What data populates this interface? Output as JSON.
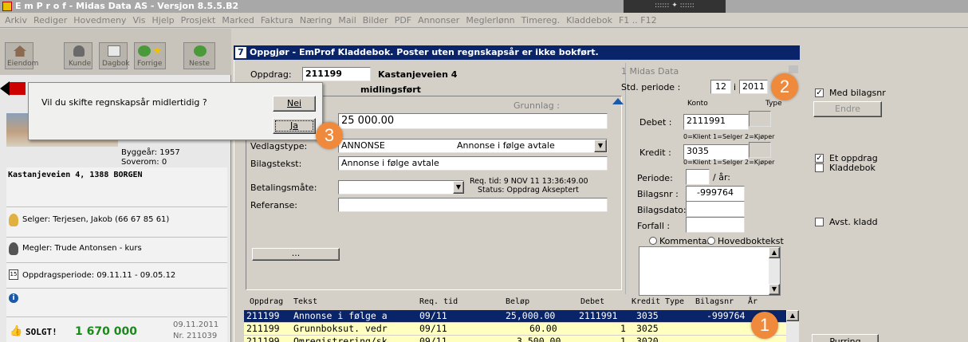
{
  "titlebar": {
    "title": "E m P r o f - Midas Data AS - Versjon 8.5.5.B2",
    "center_control": ":::::: ✦ ::::::"
  },
  "menubar": [
    "Arkiv",
    "Rediger",
    "Hovedmeny",
    "Vis",
    "Hjelp",
    "Prosjekt",
    "Marked",
    "Faktura",
    "Næring",
    "Mail",
    "Bilder",
    "PDF",
    "Annonser",
    "Meglerlønn",
    "Timereg.",
    "Kladdebok",
    "F1 .. F12"
  ],
  "toolbar": [
    "Eiendom",
    "Kunde",
    "Dagbok",
    "Forrige",
    "Neste"
  ],
  "sidebar": {
    "build_year": "Byggeår: 1957",
    "bedrooms": "Soverom: 0",
    "address": "Kastanjeveien 4, 1388 BORGEN",
    "seller": "Selger: Terjesen, Jakob (66 67 85 61)",
    "broker": "Megler: Trude Antonsen - kurs",
    "period": "Oppdragsperiode: 09.11.11 - 09.05.12",
    "period_icon_text": "15",
    "sold_label": "SOLGT!",
    "sold_price": "1 670 000",
    "sold_date": "09.11.2011",
    "sold_nr": "Nr.  211039"
  },
  "dialog": {
    "question": "Vil du skifte regnskapsår midlertidig ?",
    "no_label": "Nei",
    "yes_label": "Ja"
  },
  "window": {
    "title": "Oppgjør - EmProf Kladdebok. Poster uten regnskapsår er ikke bokført."
  },
  "form": {
    "oppdrag_label": "Oppdrag:",
    "oppdrag_value": "211199",
    "address": "Kastanjeveien 4",
    "status_partial": "midlingsført",
    "grunnlag_label": "Grunnlag :",
    "amount": "25 000.00",
    "vedlegg_label": "Vedlagstype:",
    "vedlegg_code": "ANNONSE",
    "vedlegg_desc": "Annonse i følge avtale",
    "bilagstekst_label": "Bilagstekst:",
    "bilagstekst_value": "Annonse i følge avtale",
    "betaling_label": "Betalingsmåte:",
    "referanse_label": "Referanse:",
    "req_tid": "Req. tid: 9 NOV 11  13:36:49.00",
    "status": "Status: Oppdrag Akseptert",
    "ellipsis": "..."
  },
  "right_panel": {
    "company": "1 Midas Data",
    "std_periode_label": "Std. periode :",
    "periode_month": "12",
    "periode_sep": "i",
    "periode_year": "2011",
    "konto_hdr": "Konto",
    "type_hdr": "Type",
    "debet_label": "Debet :",
    "debet_value": "2111991",
    "kredit_label": "Kredit :",
    "kredit_value": "3035",
    "hint": "0=Klient 1=Selger 2=Kjøper",
    "periode_label": "Periode:",
    "aar_label": "/ år:",
    "bilagsnr_label": "Bilagsnr :",
    "bilagsnr_value": "-999764",
    "bilagsdato_label": "Bilagsdato:",
    "forfall_label": "Forfall :",
    "kommentar_label": "Kommentar",
    "hovedbok_label": "Hovedboktekst"
  },
  "far_right": {
    "med_bilagsnr": "Med bilagsnr",
    "endre": "Endre",
    "et_oppdrag": "Et oppdrag",
    "kladdebok": "Kladdebok",
    "avst_kladd": "Avst. kladd",
    "purring": "Purring"
  },
  "grid": {
    "headers": [
      "Oppdrag",
      "Tekst",
      "Req. tid",
      "Beløp",
      "Debet",
      "Kredit",
      "Type",
      "Bilagsnr",
      "År"
    ],
    "rows": [
      [
        "211199",
        "Annonse i følge a",
        "09/11",
        "25,000.00",
        "2111991",
        "3035",
        "",
        "-999764",
        ""
      ],
      [
        "211199",
        "Grunnboksut. vedr",
        "09/11",
        "60.00",
        "1",
        "3025",
        "",
        "",
        ""
      ],
      [
        "211199",
        "Omregistrering/sk",
        "09/11",
        "3,500.00",
        "1",
        "3020",
        "",
        "",
        ""
      ]
    ]
  },
  "badges": [
    "1",
    "2",
    "3"
  ],
  "colors": {
    "titlebar": "#d4d0c8",
    "window_title": "#0a246a",
    "selected_row": "#0a246a",
    "grid_row": "#ffffc0",
    "badge": "#ef8a3c",
    "sold_green": "#1a8a1a"
  }
}
